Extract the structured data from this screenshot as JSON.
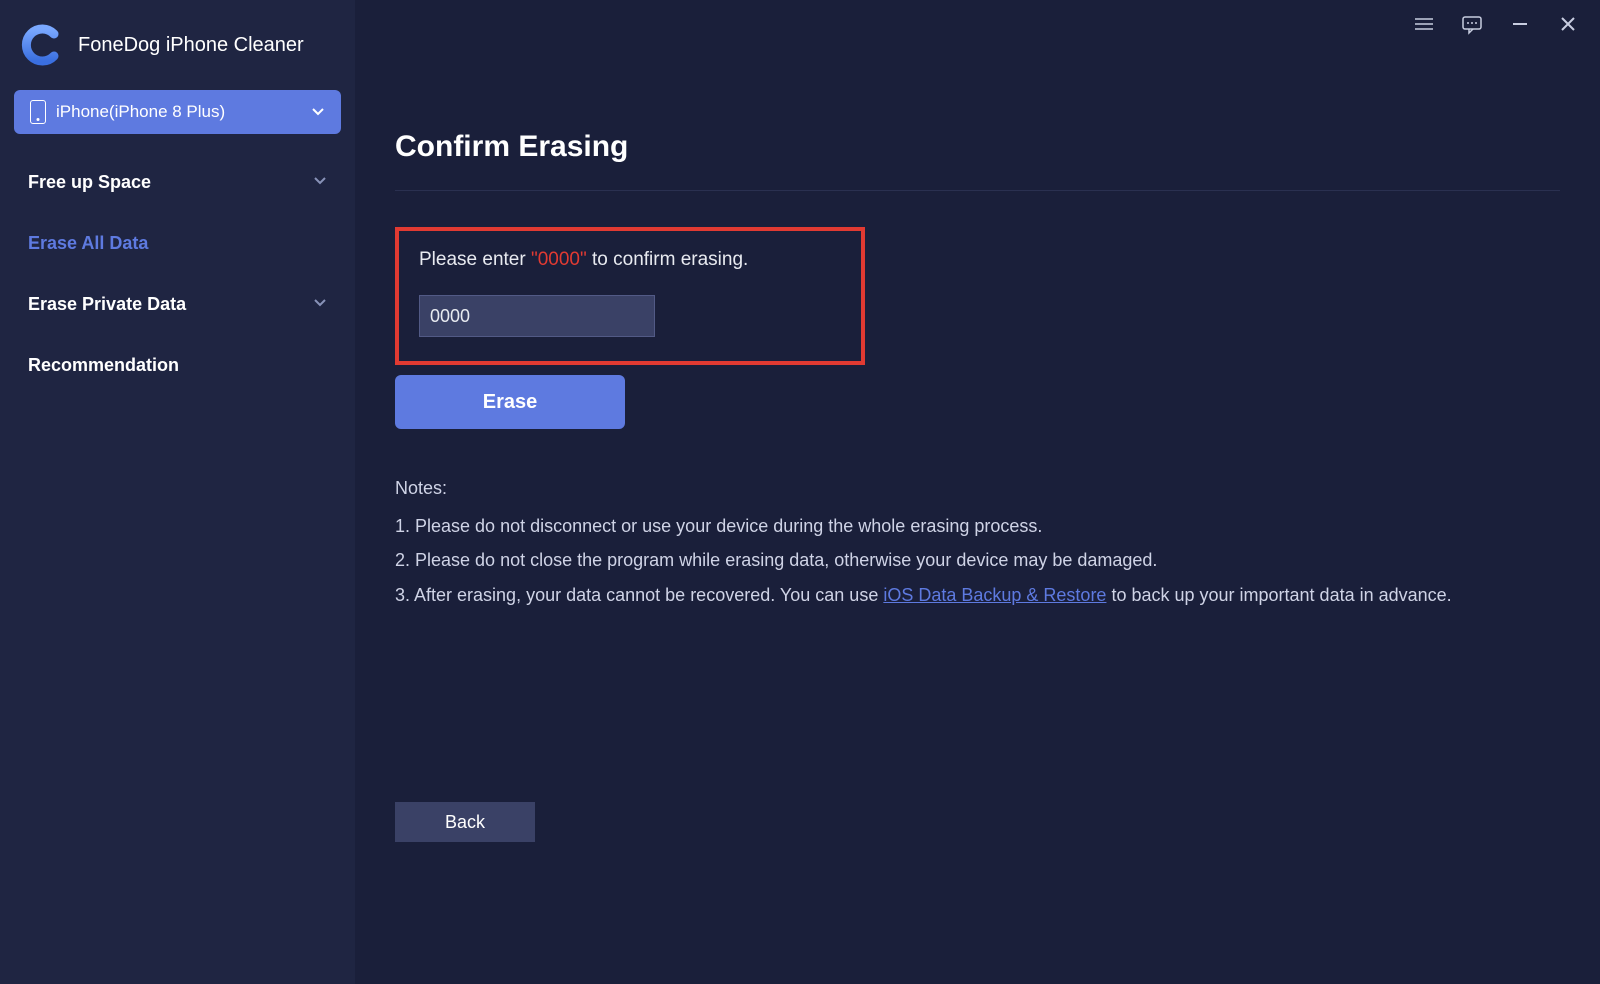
{
  "app": {
    "title": "FoneDog iPhone Cleaner"
  },
  "device": {
    "label": "iPhone(iPhone 8 Plus)"
  },
  "sidebar": {
    "items": [
      {
        "label": "Free up Space",
        "expandable": true
      },
      {
        "label": "Erase All Data",
        "expandable": false
      },
      {
        "label": "Erase Private Data",
        "expandable": true
      },
      {
        "label": "Recommendation",
        "expandable": false
      }
    ]
  },
  "page": {
    "title": "Confirm Erasing",
    "instruction_prefix": "Please enter ",
    "instruction_code": "\"0000\"",
    "instruction_suffix": " to confirm erasing.",
    "input_value": "0000",
    "erase_label": "Erase",
    "back_label": "Back"
  },
  "notes": {
    "title": "Notes:",
    "n1": "1. Please do not disconnect or use your device during the whole erasing process.",
    "n2": "2. Please do not close the program while erasing data, otherwise your device may be damaged.",
    "n3_pre": "3. After erasing, your data cannot be recovered. You can use ",
    "n3_link": "iOS Data Backup & Restore",
    "n3_post": " to back up your important data in advance."
  }
}
